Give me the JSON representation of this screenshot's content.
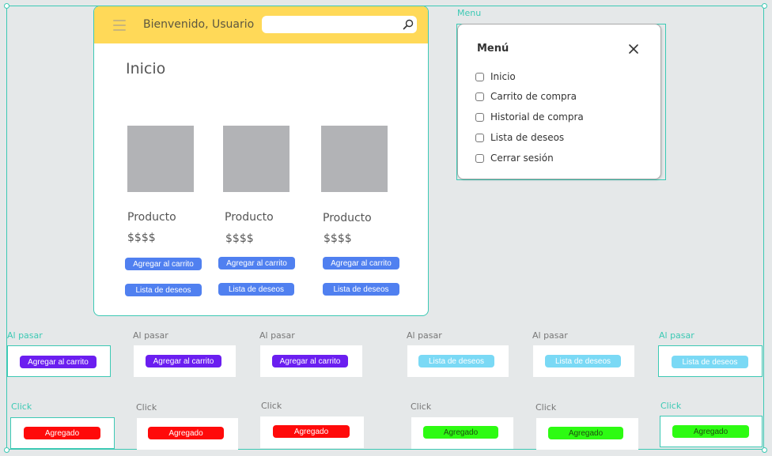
{
  "main": {
    "welcome": "Bienvenido, Usuario",
    "search_placeholder": "",
    "page_title": "Inicio",
    "products": [
      {
        "name": "Producto",
        "price": "$$$$",
        "cart_label": "Agregar al carrito",
        "wish_label": "Lista de deseos"
      },
      {
        "name": "Producto",
        "price": "$$$$",
        "cart_label": "Agregar al carrito",
        "wish_label": "Lista de deseos"
      },
      {
        "name": "Producto",
        "price": "$$$$",
        "cart_label": "Agregar al carrito",
        "wish_label": "Lista de deseos"
      }
    ]
  },
  "menu": {
    "frame_label": "Menu",
    "title": "Menú",
    "items": [
      "Inicio",
      "Carrito de compra",
      "Historial de compra",
      "Lista de deseos",
      "Cerrar sesión"
    ]
  },
  "states": {
    "hover_label": "Al pasar",
    "click_label": "Click",
    "hover_buttons": [
      "Agregar al carrito",
      "Agregar al carrito",
      "Agregar al carrito",
      "Lista de deseos",
      "Lista de deseos",
      "Lista de deseos"
    ],
    "click_buttons": [
      "Agregado",
      "Agregado",
      "Agregado",
      "Agregado",
      "Agregado",
      "Agregado"
    ]
  },
  "colors": {
    "topbar": "#ffd958",
    "primary_button": "#5080f0",
    "hover_cart": "#6b1ef0",
    "hover_wishlist": "#7ad9f5",
    "click_cart": "#ff0a0a",
    "click_wishlist": "#2dfb12",
    "selection": "#3cc9b4"
  },
  "icons": [
    "hamburger-icon",
    "search-icon",
    "close-icon",
    "checkbox-icon"
  ]
}
